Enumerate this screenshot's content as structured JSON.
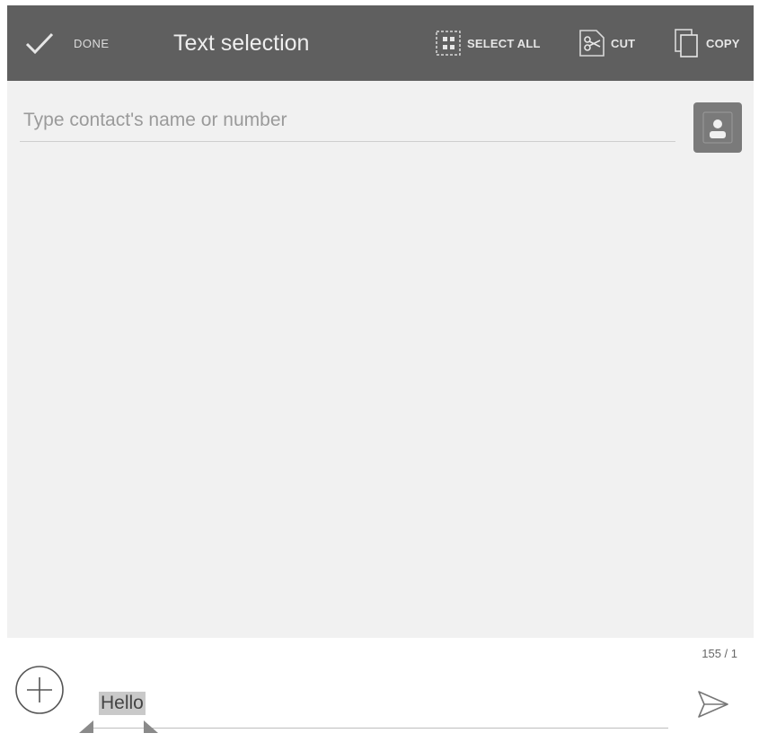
{
  "action_bar": {
    "done_label": "DONE",
    "title": "Text selection",
    "select_all_label": "SELECT ALL",
    "cut_label": "CUT",
    "copy_label": "COPY"
  },
  "recipient": {
    "placeholder": "Type contact's name or number"
  },
  "compose": {
    "counter": "155 / 1",
    "message_text": "Hello"
  },
  "icons": {
    "done": "check-icon",
    "select_all": "select-all-icon",
    "cut": "scissors-icon",
    "copy": "copy-icon",
    "contact": "contact-card-icon",
    "attach": "plus-circle-icon",
    "send": "send-icon"
  },
  "colors": {
    "action_bar": "#5f5f5f",
    "background": "#f1f1f1",
    "selection": "#c9c9c9"
  }
}
